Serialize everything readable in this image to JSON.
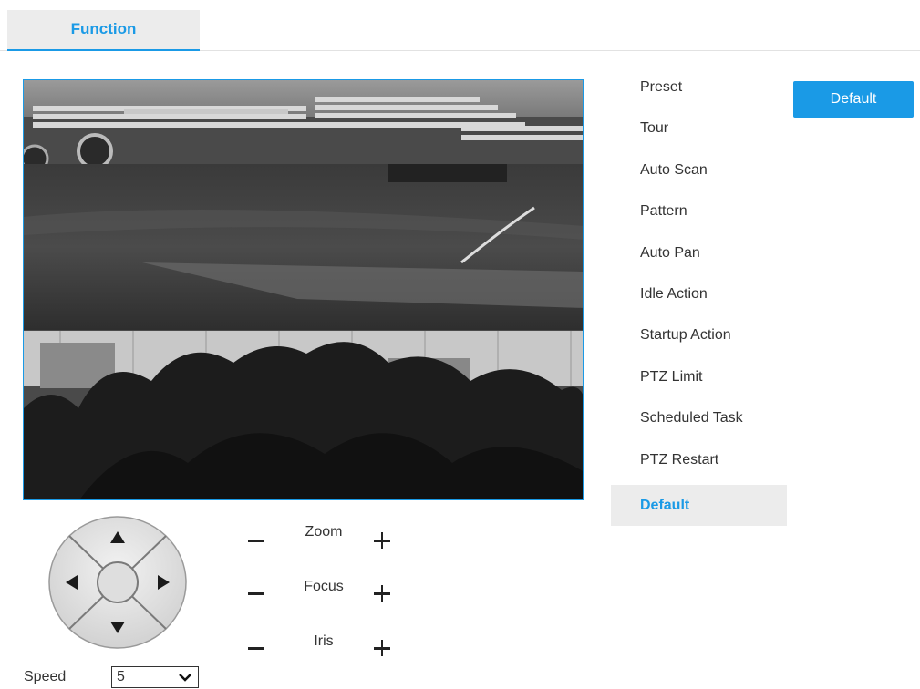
{
  "tabs": [
    {
      "label": "Function",
      "active": true
    }
  ],
  "menu": {
    "items": [
      {
        "label": "Preset"
      },
      {
        "label": "Tour"
      },
      {
        "label": "Auto Scan"
      },
      {
        "label": "Pattern"
      },
      {
        "label": "Auto Pan"
      },
      {
        "label": "Idle Action"
      },
      {
        "label": "Startup Action"
      },
      {
        "label": "PTZ Limit"
      },
      {
        "label": "Scheduled Task"
      },
      {
        "label": "PTZ Restart"
      },
      {
        "label": "Default",
        "active": true
      }
    ]
  },
  "action": {
    "default_label": "Default"
  },
  "lens": {
    "zoom_label": "Zoom",
    "focus_label": "Focus",
    "iris_label": "Iris"
  },
  "speed": {
    "label": "Speed",
    "value": "5"
  },
  "icons": {
    "pad": "ptz-direction-pad-icon",
    "up": "arrow-up-icon",
    "down": "arrow-down-icon",
    "left": "arrow-left-icon",
    "right": "arrow-right-icon",
    "minus": "minus-icon",
    "plus": "plus-icon",
    "dropdown": "chevron-down-icon"
  },
  "colors": {
    "accent": "#1a9ae6",
    "tab_bg": "#ececec",
    "text": "#333333"
  }
}
